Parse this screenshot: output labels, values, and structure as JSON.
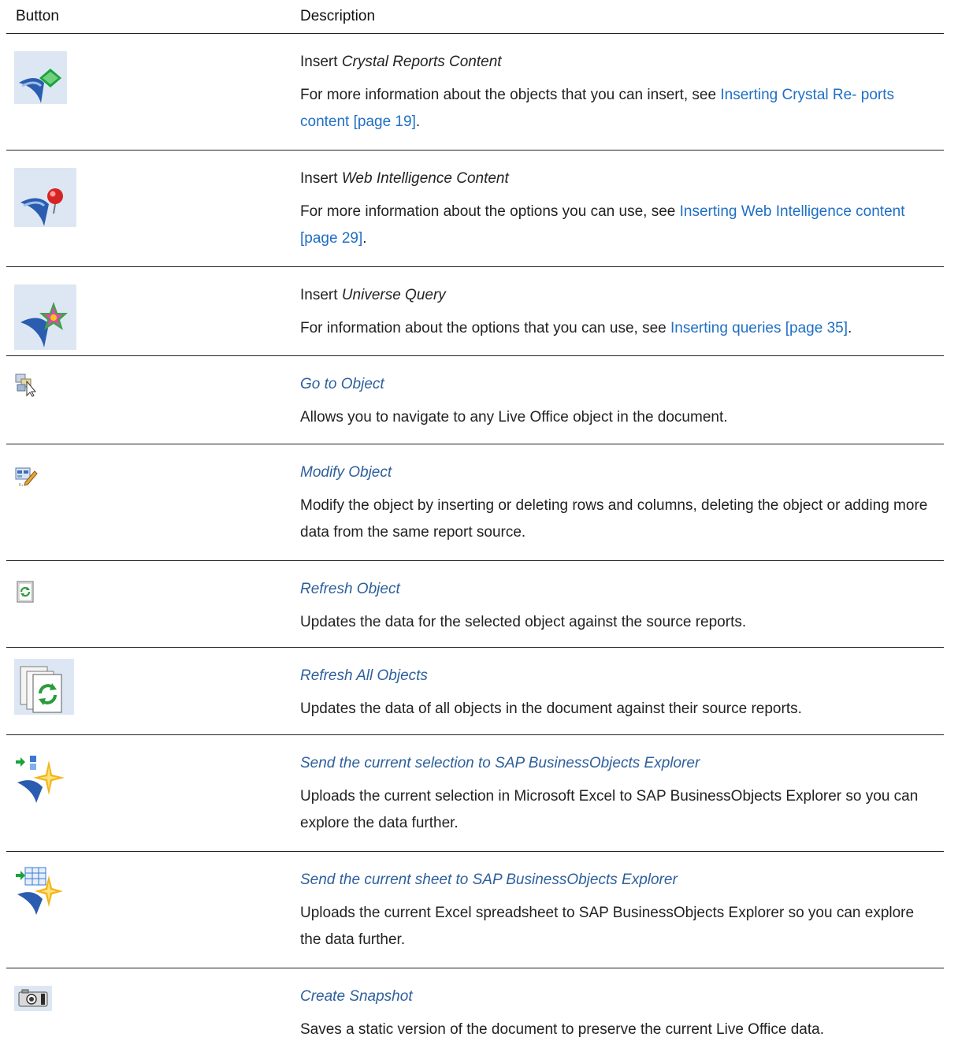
{
  "header": {
    "col_button": "Button",
    "col_description": "Description"
  },
  "rows": [
    {
      "icon": "crystal-reports-icon",
      "title_prefix": "Insert ",
      "title": "Crystal Reports Content",
      "body_prefix": "For more information about the objects that you can insert, see ",
      "body_link": "Inserting Crystal Re- ports content [page 19]",
      "body_suffix": "."
    },
    {
      "icon": "web-intelligence-icon",
      "title_prefix": "Insert ",
      "title": "Web Intelligence Content",
      "body_prefix": "For more information about the options you can use, see ",
      "body_link": "Inserting Web Intelligence content [page 29]",
      "body_suffix": "."
    },
    {
      "icon": "universe-query-icon",
      "title_prefix": "Insert ",
      "title": "Universe Query",
      "body_prefix": "For information about the options that you can use, see ",
      "body_link": "Inserting queries [page 35]",
      "body_suffix": "."
    },
    {
      "icon": "go-to-object-icon",
      "title": "Go to Object",
      "body": "Allows you to navigate to any Live Office object in the document."
    },
    {
      "icon": "modify-object-icon",
      "title": "Modify Object",
      "body": "Modify the object by inserting or deleting rows and columns, deleting the object or adding more data from the same report source."
    },
    {
      "icon": "refresh-object-icon",
      "title": "Refresh Object",
      "body": "Updates the data for the selected object against the source reports."
    },
    {
      "icon": "refresh-all-objects-icon",
      "title": "Refresh All Objects",
      "body": "Updates the data of all objects in the document against their source reports."
    },
    {
      "icon": "send-selection-explorer-icon",
      "title": "Send the current selection to SAP BusinessObjects Explorer",
      "body": "Uploads the current selection in Microsoft Excel to SAP BusinessObjects Explorer so you can explore the data further."
    },
    {
      "icon": "send-sheet-explorer-icon",
      "title": "Send the current sheet to SAP BusinessObjects Explorer",
      "body": "Uploads the current Excel spreadsheet to SAP BusinessObjects Explorer so you can explore the data further."
    },
    {
      "icon": "camera-icon",
      "title": "Create Snapshot",
      "body": "Saves a static version of the document to preserve the current Live Office data."
    }
  ]
}
